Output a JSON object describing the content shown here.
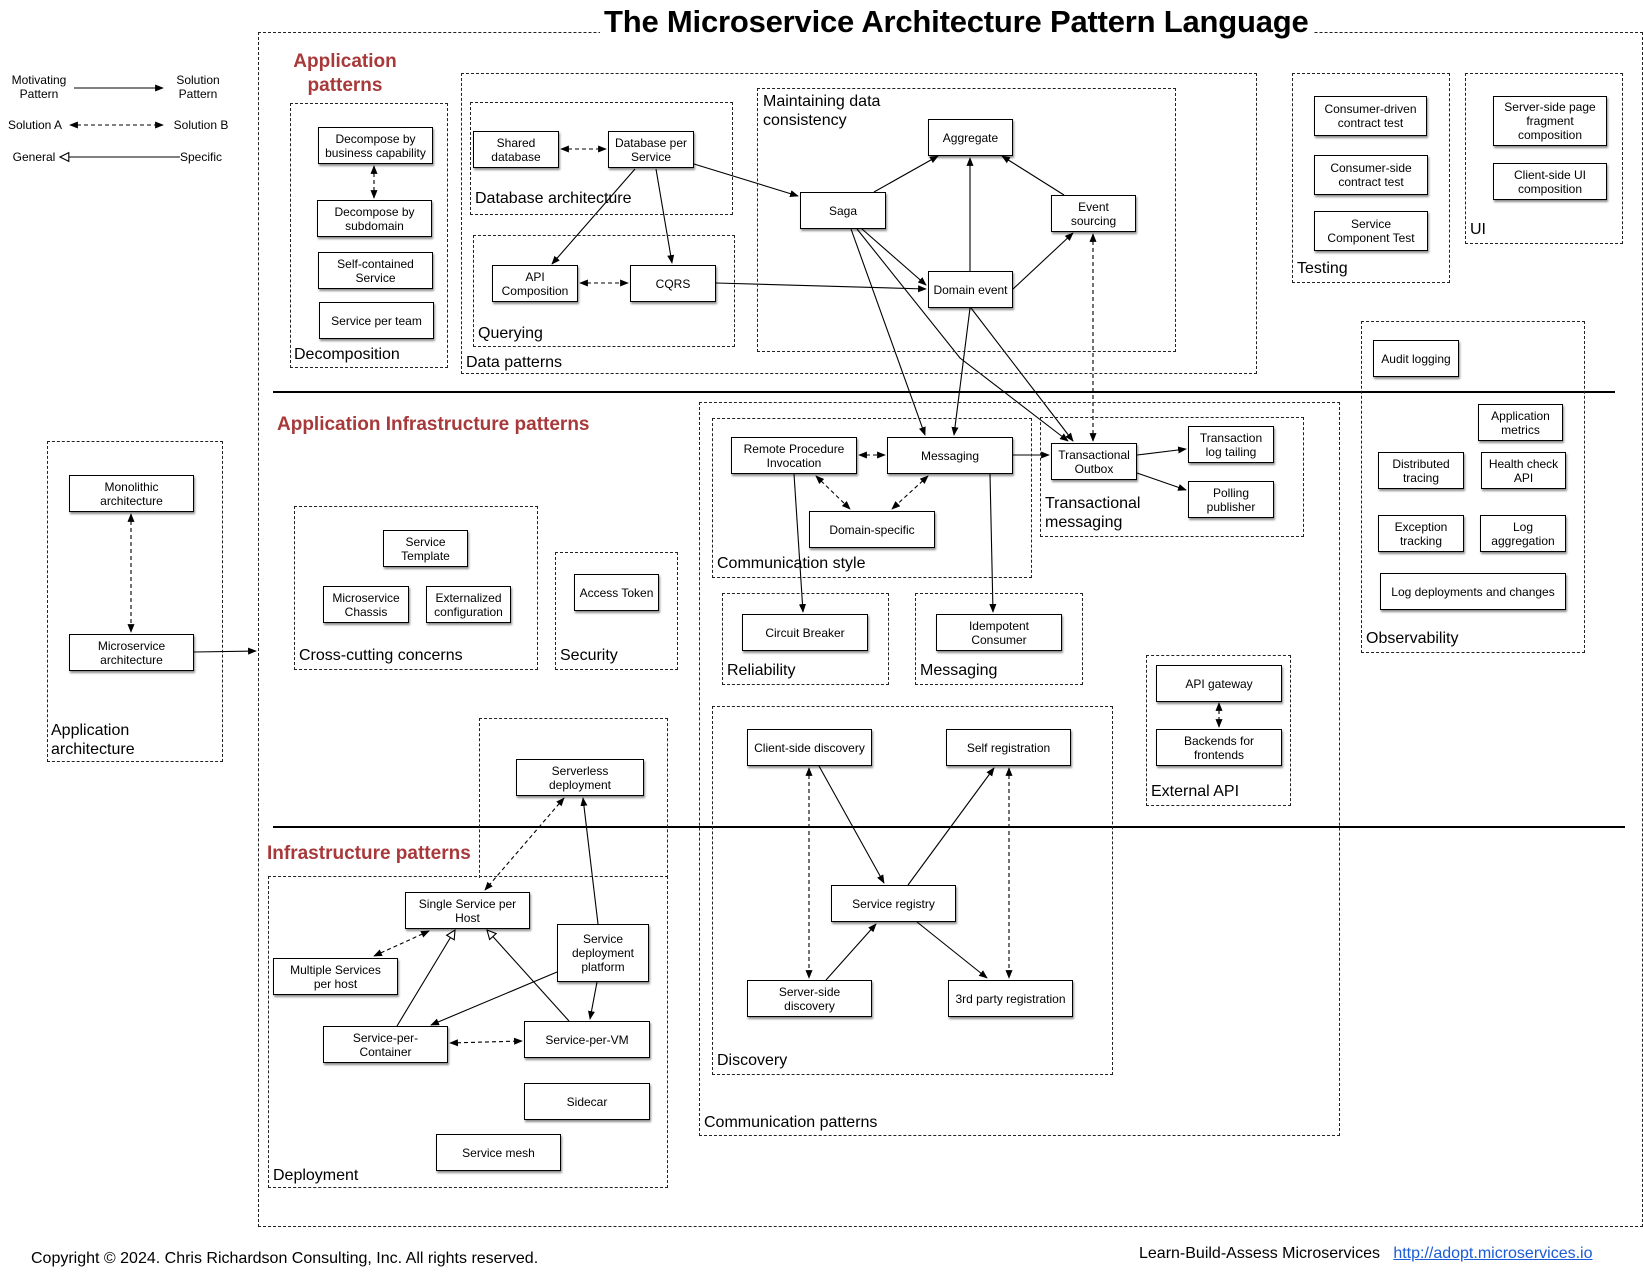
{
  "title": "The Microservice Architecture Pattern Language",
  "legend": {
    "motivating": "Motivating\nPattern",
    "solution": "Solution\nPattern",
    "solution_a": "Solution A",
    "solution_b": "Solution B",
    "general": "General",
    "specific": "Specific"
  },
  "sections": {
    "application": "Application\npatterns",
    "app_infra": "Application Infrastructure patterns",
    "infra": "Infrastructure patterns"
  },
  "groups": {
    "decomposition": "Decomposition",
    "database_architecture": "Database architecture",
    "querying": "Querying",
    "data_patterns": "Data patterns",
    "maintaining_consistency": "Maintaining data\nconsistency",
    "testing": "Testing",
    "ui": "UI",
    "observability": "Observability",
    "application_architecture": "Application\narchitecture",
    "cross_cutting": "Cross-cutting concerns",
    "security": "Security",
    "communication_style": "Communication style",
    "transactional_messaging": "Transactional\nmessaging",
    "reliability": "Reliability",
    "messaging": "Messaging",
    "external_api": "External API",
    "discovery": "Discovery",
    "communication_patterns": "Communication patterns",
    "deployment": "Deployment"
  },
  "nodes": {
    "decompose_capability": "Decompose by\nbusiness capability",
    "decompose_subdomain": "Decompose by\nsubdomain",
    "self_contained": "Self-contained\nService",
    "service_per_team": "Service per team",
    "shared_database": "Shared\ndatabase",
    "database_per_service": "Database per\nService",
    "api_composition": "API\nComposition",
    "cqrs": "CQRS",
    "aggregate": "Aggregate",
    "saga": "Saga",
    "event_sourcing": "Event\nsourcing",
    "domain_event": "Domain event",
    "consumer_driven": "Consumer-driven\ncontract test",
    "consumer_side": "Consumer-side\ncontract test",
    "service_component": "Service\nComponent Test",
    "server_side_page": "Server-side page\nfragment\ncomposition",
    "client_side_ui": "Client-side  UI\ncomposition",
    "audit_logging": "Audit logging",
    "application_metrics": "Application\nmetrics",
    "distributed_tracing": "Distributed\ntracing",
    "health_check": "Health check\nAPI",
    "exception_tracking": "Exception\ntracking",
    "log_aggregation": "Log\naggregation",
    "log_deployments": "Log deployments and changes",
    "monolithic": "Monolithic\narchitecture",
    "microservice": "Microservice\narchitecture",
    "service_template": "Service\nTemplate",
    "microservice_chassis": "Microservice\nChassis",
    "externalized_config": "Externalized\nconfiguration",
    "access_token": "Access Token",
    "rpi": "Remote Procedure\nInvocation",
    "messaging": "Messaging",
    "domain_specific": "Domain-specific",
    "transactional_outbox": "Transactional\nOutbox",
    "transaction_log_tailing": "Transaction\nlog tailing",
    "polling_publisher": "Polling\npublisher",
    "circuit_breaker": "Circuit Breaker",
    "idempotent_consumer": "Idempotent\nConsumer",
    "api_gateway": "API gateway",
    "bff": "Backends for\nfrontends",
    "client_side_discovery": "Client-side discovery",
    "self_registration": "Self registration",
    "service_registry": "Service registry",
    "server_side_discovery": "Server-side\ndiscovery",
    "third_party_registration": "3rd party registration",
    "serverless": "Serverless\ndeployment",
    "single_service_per_host": "Single Service per\nHost",
    "multiple_services_per_host": "Multiple Services\nper host",
    "service_deployment_platform": "Service\ndeployment\nplatform",
    "service_per_container": "Service-per-\nContainer",
    "service_per_vm": "Service-per-VM",
    "sidecar": "Sidecar",
    "service_mesh": "Service mesh"
  },
  "footer": {
    "copyright": "Copyright © 2024. Chris Richardson Consulting, Inc. All rights reserved.",
    "tagline": "Learn-Build-Assess Microservices",
    "link": "http://adopt.microservices.io"
  }
}
